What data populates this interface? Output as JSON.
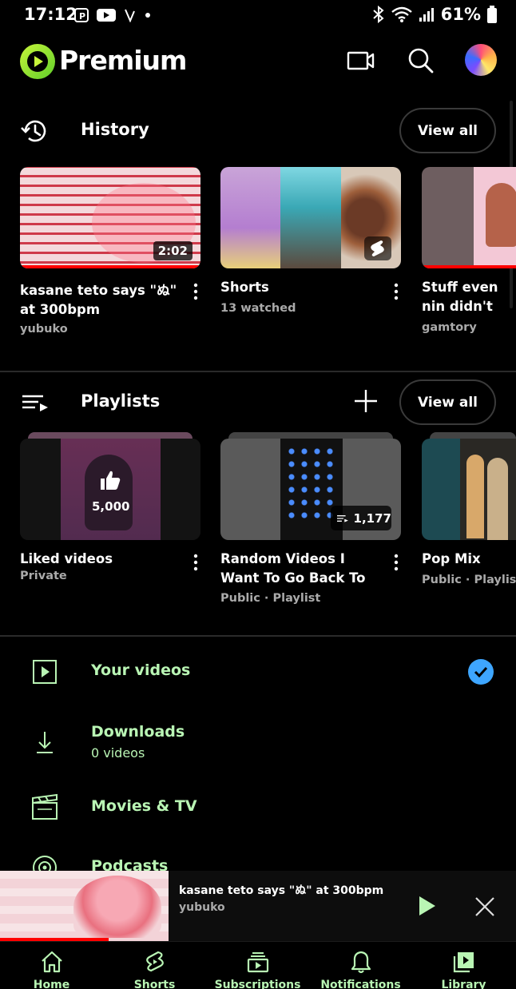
{
  "status_bar": {
    "time": "17:12",
    "battery": "61%"
  },
  "header": {
    "brand": "Premium"
  },
  "history": {
    "title": "History",
    "view_all": "View all",
    "items": [
      {
        "title": "kasane teto says \"ぬ\" at 300bpm",
        "subtitle": "yubuko",
        "duration": "2:02"
      },
      {
        "title": "Shorts",
        "subtitle": "13 watched"
      },
      {
        "title": "Stuff even nin didn't see com",
        "subtitle": "gamtory"
      }
    ]
  },
  "playlists": {
    "title": "Playlists",
    "view_all": "View all",
    "items": [
      {
        "title": "Liked videos",
        "subtitle": "Private",
        "count": "5,000"
      },
      {
        "title": "Random Videos I Want To Go Back To",
        "subtitle": "Public · Playlist",
        "count": "1,177"
      },
      {
        "title": "Pop Mix",
        "subtitle": "Public · Playlist"
      }
    ]
  },
  "menu": {
    "your_videos": "Your videos",
    "downloads": "Downloads",
    "downloads_sub": "0 videos",
    "movies": "Movies & TV",
    "podcasts": "Podcasts"
  },
  "mini_player": {
    "title": "kasane teto says \"ぬ\" at 300bpm",
    "channel": "yubuko",
    "progress": 0.21
  },
  "nav": {
    "home": "Home",
    "shorts": "Shorts",
    "subscriptions": "Subscriptions",
    "notifications": "Notifications",
    "library": "Library"
  },
  "colors": {
    "accent_green": "#b9f5b4",
    "progress_red": "#ff0000",
    "check_blue": "#3ea6ff",
    "logo_lime": "#9bea1b"
  }
}
